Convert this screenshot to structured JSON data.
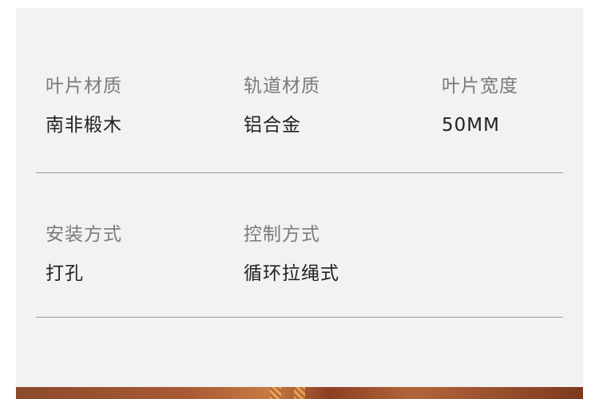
{
  "specs": {
    "blade_material": {
      "label": "叶片材质",
      "value": "南非椴木"
    },
    "track_material": {
      "label": "轨道材质",
      "value": "铝合金"
    },
    "blade_width": {
      "label": "叶片宽度",
      "value": "50MM"
    },
    "installation": {
      "label": "安装方式",
      "value": "打孔"
    },
    "control": {
      "label": "控制方式",
      "value": "循环拉绳式"
    }
  },
  "colors": {
    "panel_background": "#f2f2f2",
    "label_text": "#7a7a7a",
    "value_text": "#222222",
    "divider": "#9a9a9a"
  }
}
